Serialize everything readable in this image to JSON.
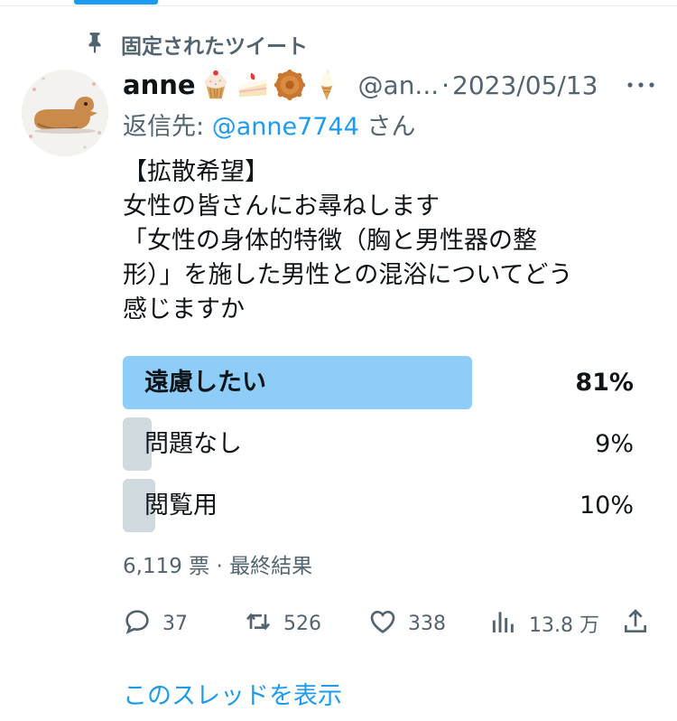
{
  "pinned_label": "固定されたツイート",
  "tweet": {
    "display_name": "anne",
    "name_emojis": [
      "cupcake-emoji",
      "shortcake-emoji",
      "mooncake-emoji",
      "soft-ice-cream-emoji"
    ],
    "handle": "@an...",
    "separator": "·",
    "date": "2023/05/13",
    "reply_prefix": "返信先: ",
    "reply_mention": "@anne7744",
    "reply_suffix": " さん",
    "body_lines": [
      "【拡散希望】",
      "女性の皆さんにお尋ねします",
      "「女性の身体的特徴（胸と男性器の整",
      "形）」を施した男性との混浴についてどう",
      "感じますか"
    ]
  },
  "poll": {
    "options": [
      {
        "label": "遠慮したい",
        "percent_text": "81%",
        "fraction": 0.81,
        "winner": true
      },
      {
        "label": "問題なし",
        "percent_text": "9%",
        "fraction": 0.09,
        "winner": false
      },
      {
        "label": "閲覧用",
        "percent_text": "10%",
        "fraction": 0.1,
        "winner": false
      }
    ],
    "votes": "6,119 票",
    "separator": "·",
    "status": "最終結果"
  },
  "actions": {
    "replies": "37",
    "retweets": "526",
    "likes": "338",
    "views": "13.8 万"
  },
  "show_thread": "このスレッドを表示",
  "colors": {
    "accent": "#1d9bf0",
    "winner_bar": "#8ecdf8",
    "other_bar": "#cfd9de",
    "secondary_text": "#536471"
  }
}
